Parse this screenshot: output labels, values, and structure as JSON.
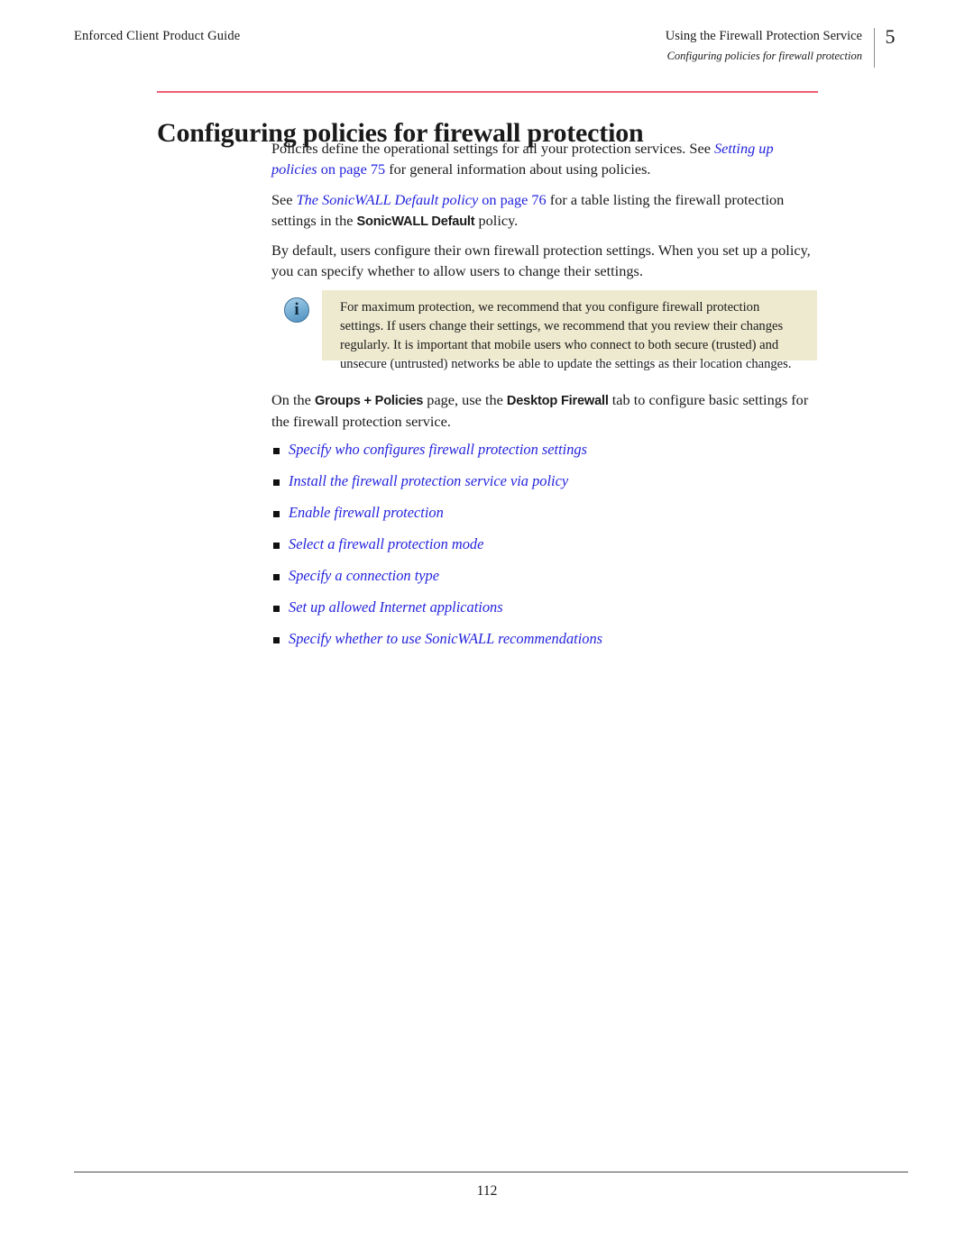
{
  "header": {
    "left_title": "Enforced Client Product Guide",
    "chapter_title": "Using the Firewall Protection Service",
    "section_title": "Configuring policies for firewall protection",
    "chapter_number": "5"
  },
  "title": {
    "heading": "Configuring policies for firewall protection",
    "rule_color": "#ef5d72"
  },
  "paragraphs": {
    "intro": {
      "part1": "Policies define the operational settings for all your protection services. See ",
      "link_italic": "Setting up policies",
      "link_plain": " on page 75",
      "part2": " for general information about using policies."
    },
    "default_policy": {
      "part1": "See ",
      "link_italic": "The SonicWALL Default policy",
      "link_plain": " on page 76",
      "part2": " for a table listing the firewall protection settings in the ",
      "ui_bold": "SonicWALL Default",
      "part3": " policy."
    },
    "by_default": {
      "text": "By default, users configure their own firewall protection settings. When you set up a policy, you can specify whether to allow users to change their settings."
    },
    "on_the_groups": {
      "part1": "On the ",
      "ui_bold_1": "Groups + Policies",
      "part2": " page, use the ",
      "ui_bold_2": "Desktop Firewall",
      "part3": " tab to configure basic settings for the firewall protection service."
    }
  },
  "note": {
    "icon": "info-icon",
    "background_color": "#eeead0",
    "text": "For maximum protection, we recommend that you configure firewall protection settings. If users change their settings, we recommend that you review their changes regularly. It is important that mobile users who connect to both secure (trusted) and unsecure (untrusted) networks be able to update the settings as their location changes."
  },
  "link_list": {
    "bullet_glyph": "square",
    "link_color": "#2323dd",
    "items": [
      {
        "label": "Specify who configures firewall protection settings"
      },
      {
        "label": "Install the firewall protection service via policy"
      },
      {
        "label": "Enable firewall protection"
      },
      {
        "label": "Select a firewall protection mode"
      },
      {
        "label": "Specify a connection type"
      },
      {
        "label": "Set up allowed Internet applications"
      },
      {
        "label": "Specify whether to use SonicWALL recommendations"
      }
    ]
  },
  "footer": {
    "page_number": "112"
  }
}
